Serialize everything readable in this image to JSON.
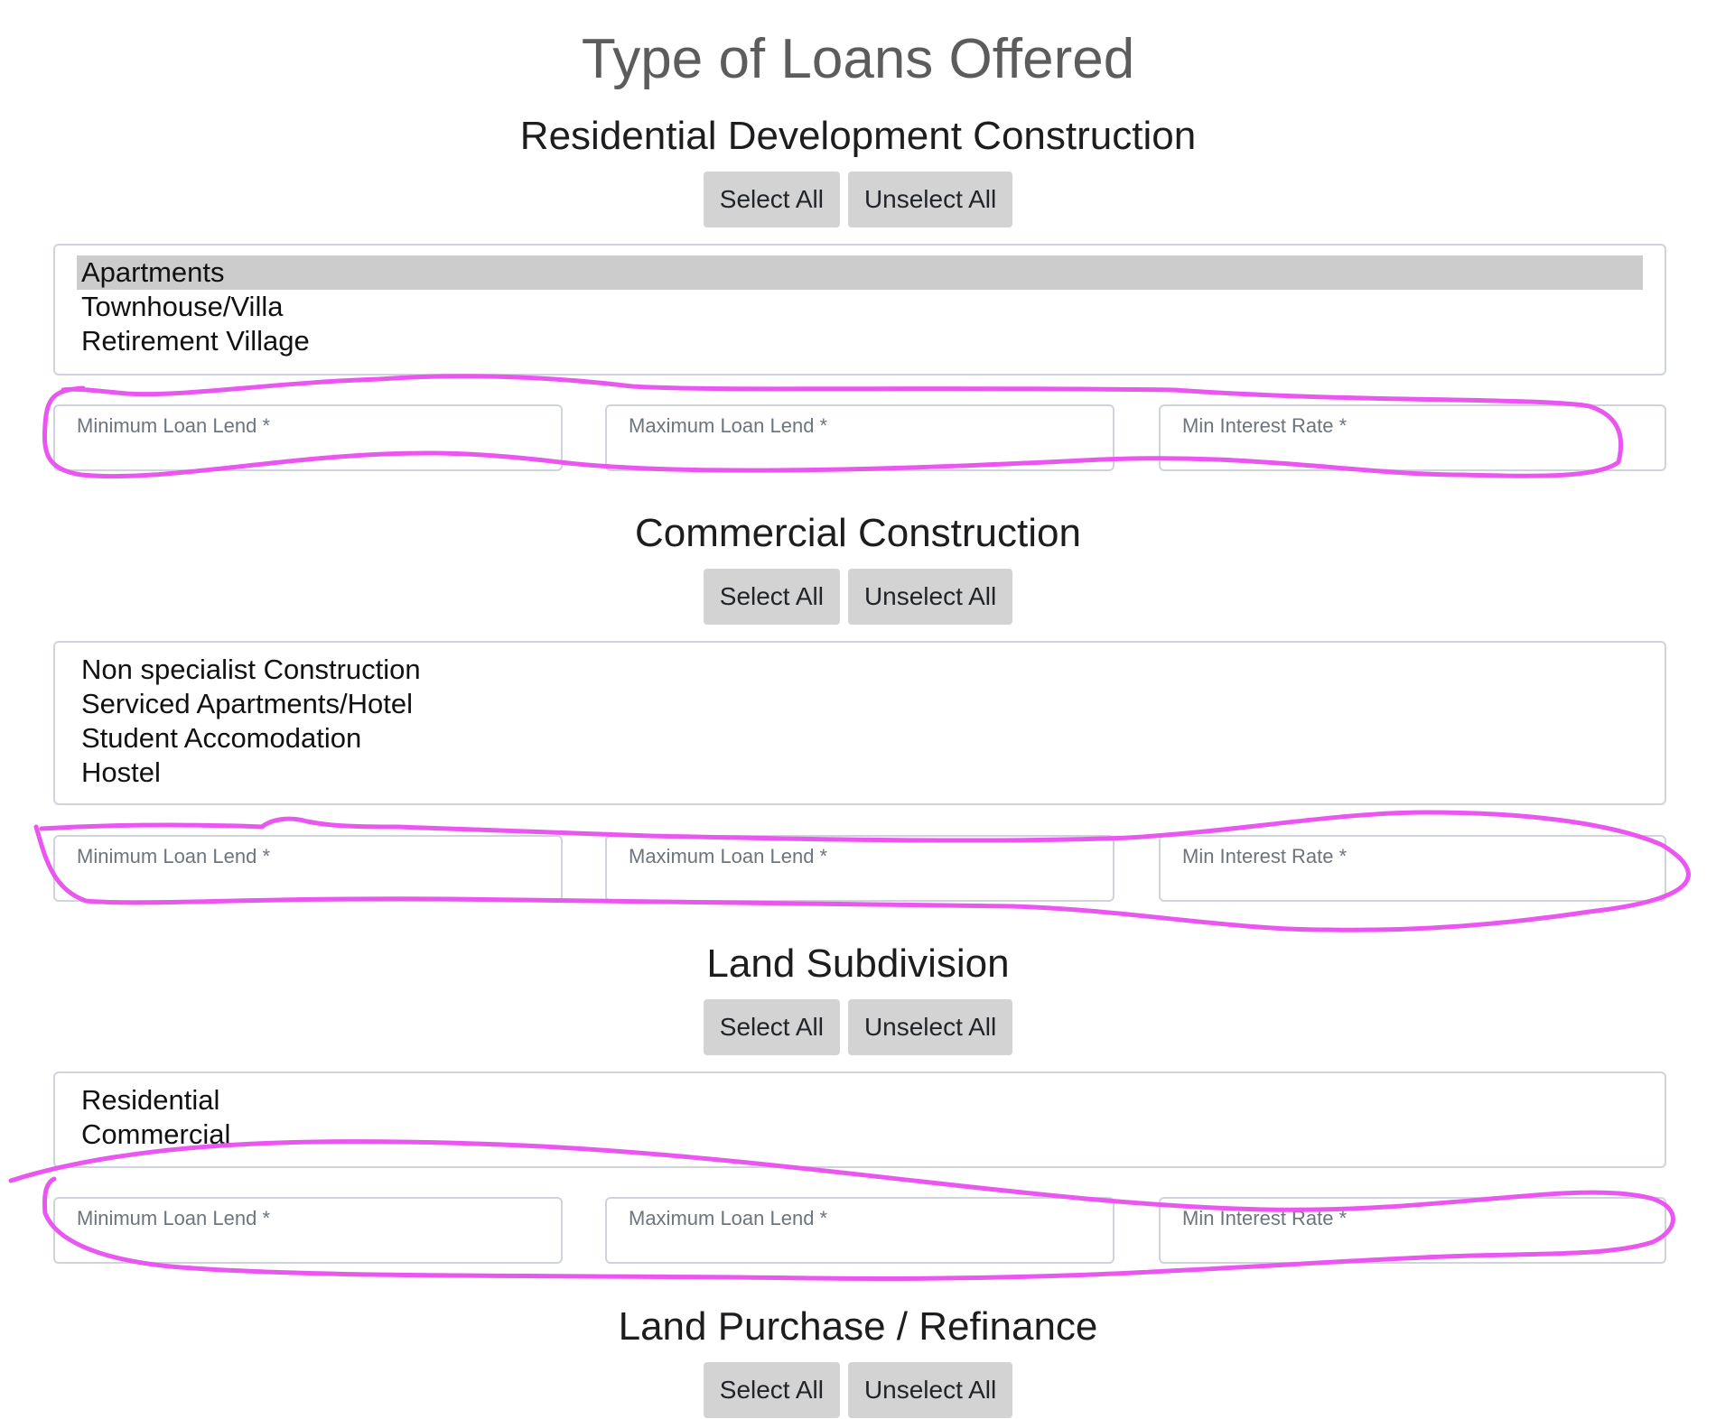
{
  "page": {
    "title": "Type of Loans Offered"
  },
  "button_labels": {
    "select_all": "Select All",
    "unselect_all": "Unselect All"
  },
  "field_placeholders": {
    "min_loan": "Minimum Loan Lend *",
    "max_loan": "Maximum Loan Lend *",
    "min_rate": "Min Interest Rate *"
  },
  "sections": [
    {
      "title": "Residential Development Construction",
      "options": [
        {
          "label": "Apartments",
          "selected": true
        },
        {
          "label": "Townhouse/Villa",
          "selected": false
        },
        {
          "label": "Retirement Village",
          "selected": false
        }
      ]
    },
    {
      "title": "Commercial Construction",
      "options": [
        {
          "label": "Non specialist Construction",
          "selected": false
        },
        {
          "label": "Serviced Apartments/Hotel",
          "selected": false
        },
        {
          "label": "Student Accomodation",
          "selected": false
        },
        {
          "label": "Hostel",
          "selected": false
        }
      ]
    },
    {
      "title": "Land Subdivision",
      "options": [
        {
          "label": "Residential",
          "selected": false
        },
        {
          "label": "Commercial",
          "selected": false
        }
      ]
    },
    {
      "title": "Land Purchase / Refinance",
      "options": []
    }
  ],
  "colors": {
    "annotation_stroke": "#e956f0",
    "selected_option_bg": "#cccccc",
    "button_bg": "#d3d3d3",
    "input_border": "#cfd4da",
    "placeholder_text": "#6c757d"
  }
}
